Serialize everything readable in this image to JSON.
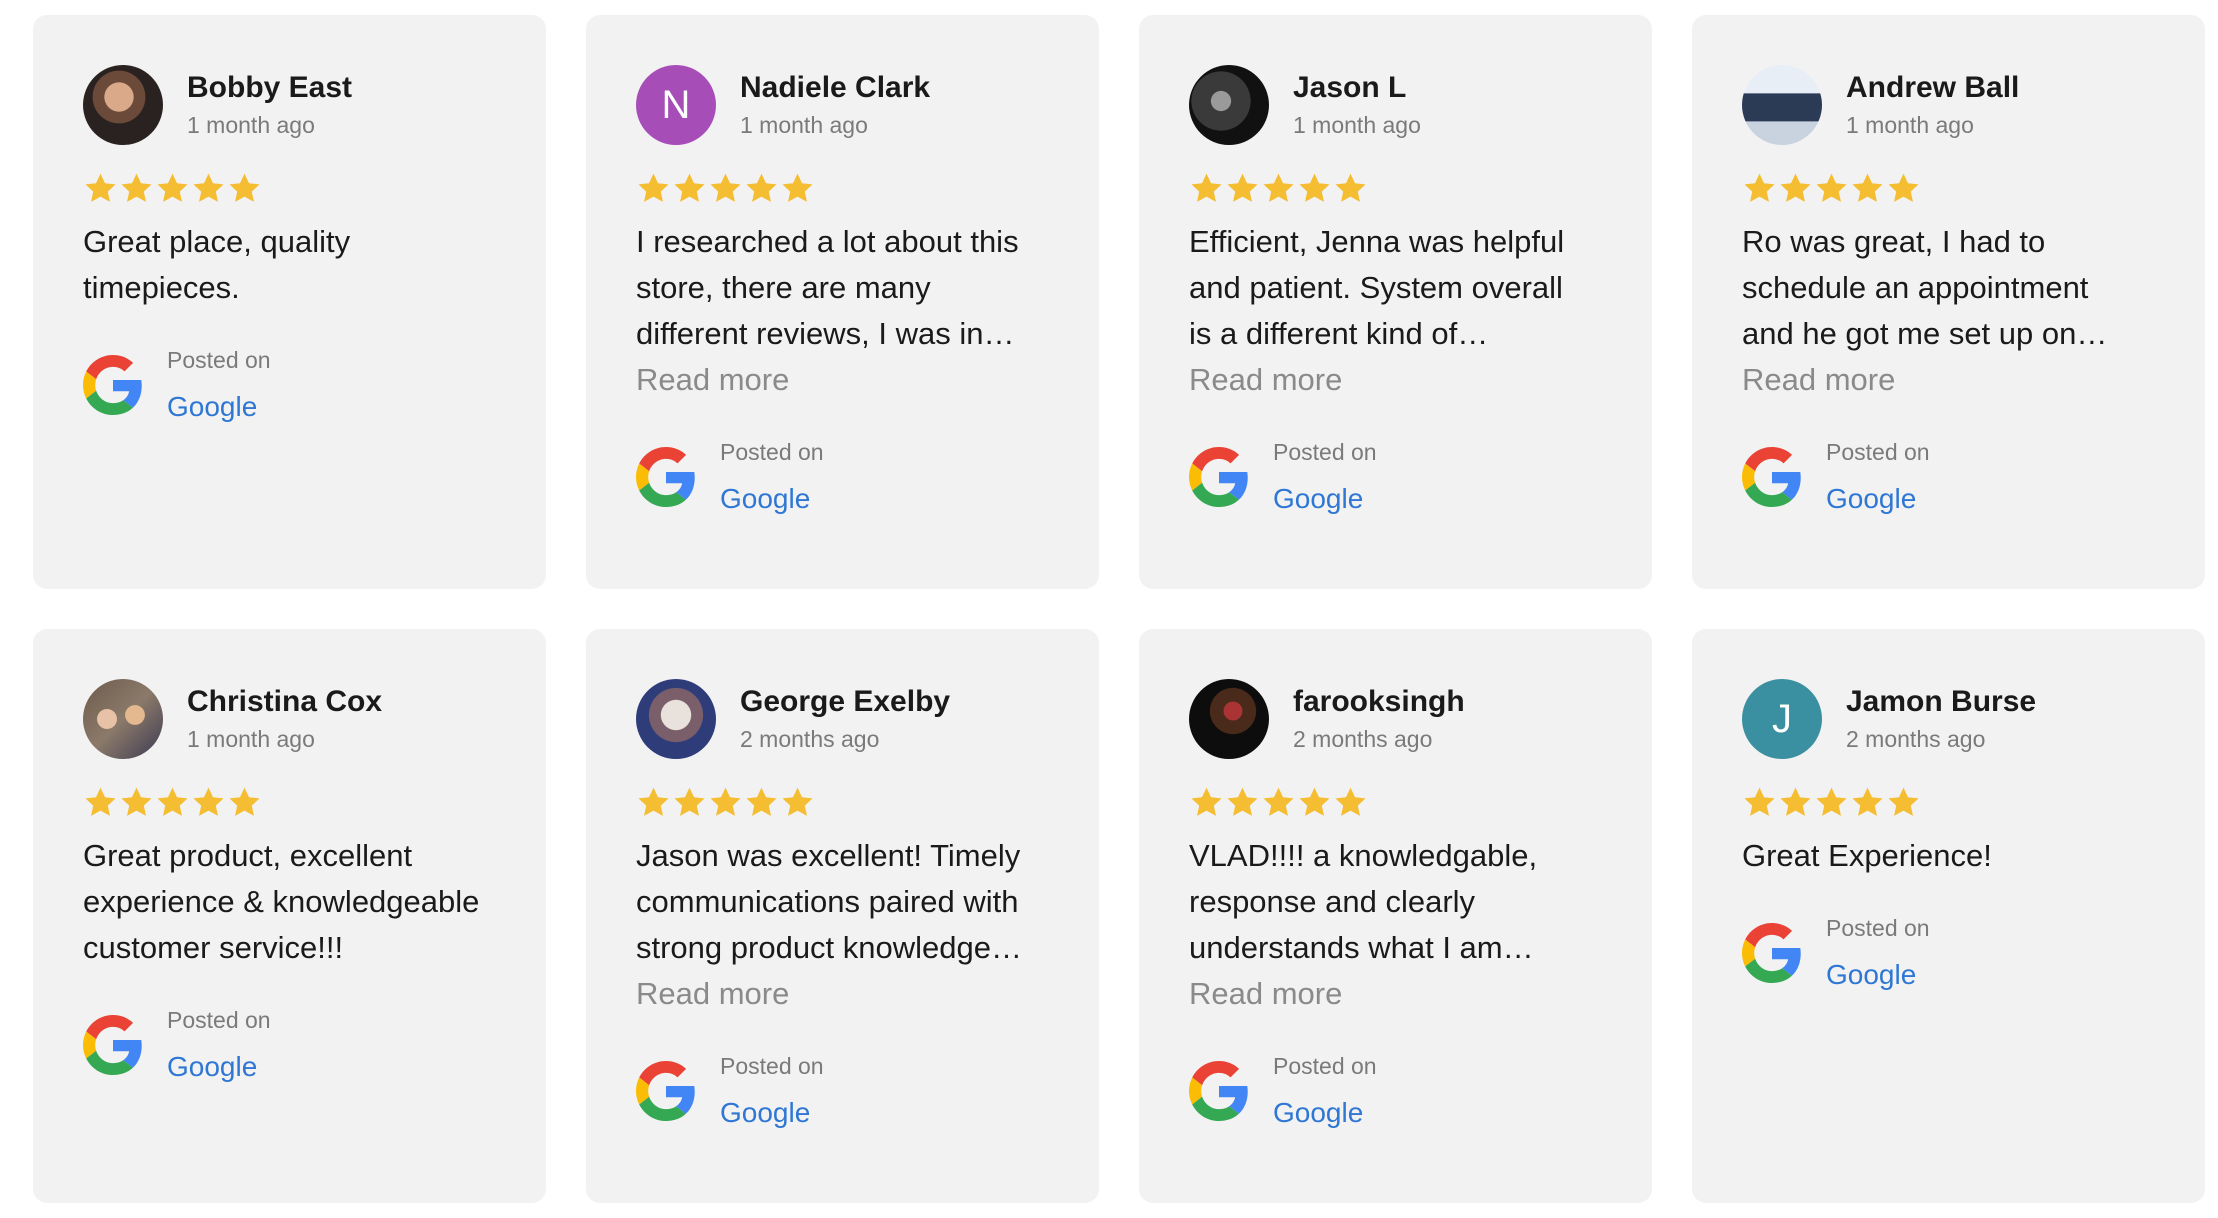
{
  "colors": {
    "card_bg": "#f2f2f2",
    "star": "#f5bd32",
    "link": "#2f77d4",
    "muted": "#7a7a7a"
  },
  "reviews": [
    {
      "name": "Bobby East",
      "date": "1 month ago",
      "rating": 5,
      "avatar": {
        "type": "photo",
        "icon": "user-photo"
      },
      "text": [
        "Great place, quality",
        "timepieces."
      ],
      "read_more": "",
      "posted_on": "Posted on",
      "site": "Google"
    },
    {
      "name": "Nadiele Clark",
      "date": "1 month ago",
      "rating": 5,
      "avatar": {
        "type": "letter",
        "letter": "N",
        "color": "#a64db8"
      },
      "text": [
        "I researched a lot about this",
        "store, there are many",
        "different reviews, I was in…"
      ],
      "read_more": "Read more",
      "posted_on": "Posted on",
      "site": "Google"
    },
    {
      "name": "Jason L",
      "date": "1 month ago",
      "rating": 5,
      "avatar": {
        "type": "photo",
        "icon": "user-photo"
      },
      "text": [
        "Efficient, Jenna was helpful",
        "and patient. System overall",
        "is a different kind of…"
      ],
      "read_more": "Read more",
      "posted_on": "Posted on",
      "site": "Google"
    },
    {
      "name": "Andrew Ball",
      "date": "1 month ago",
      "rating": 5,
      "avatar": {
        "type": "photo",
        "icon": "user-photo"
      },
      "text": [
        "Ro was great, I had to",
        "schedule an appointment",
        "and he got me set up on…"
      ],
      "read_more": "Read more",
      "posted_on": "Posted on",
      "site": "Google"
    },
    {
      "name": "Christina Cox",
      "date": "1 month ago",
      "rating": 5,
      "avatar": {
        "type": "photo",
        "icon": "user-photo"
      },
      "text": [
        "Great product, excellent",
        "experience & knowledgeable",
        "customer service!!!"
      ],
      "read_more": "",
      "posted_on": "Posted on",
      "site": "Google"
    },
    {
      "name": "George Exelby",
      "date": "2 months ago",
      "rating": 5,
      "avatar": {
        "type": "photo",
        "icon": "user-photo"
      },
      "text": [
        "Jason was excellent! Timely",
        "communications paired with",
        "strong product knowledge…"
      ],
      "read_more": "Read more",
      "posted_on": "Posted on",
      "site": "Google"
    },
    {
      "name": "farooksingh",
      "date": "2 months ago",
      "rating": 5,
      "avatar": {
        "type": "photo",
        "icon": "user-photo"
      },
      "text": [
        "VLAD!!!! a knowledgable,",
        "response and clearly",
        "understands what I am…"
      ],
      "read_more": "Read more",
      "posted_on": "Posted on",
      "site": "Google"
    },
    {
      "name": "Jamon Burse",
      "date": "2 months ago",
      "rating": 5,
      "avatar": {
        "type": "letter",
        "letter": "J",
        "color": "#3a8fa0"
      },
      "text": [
        "Great Experience!"
      ],
      "read_more": "",
      "posted_on": "Posted on",
      "site": "Google"
    }
  ]
}
